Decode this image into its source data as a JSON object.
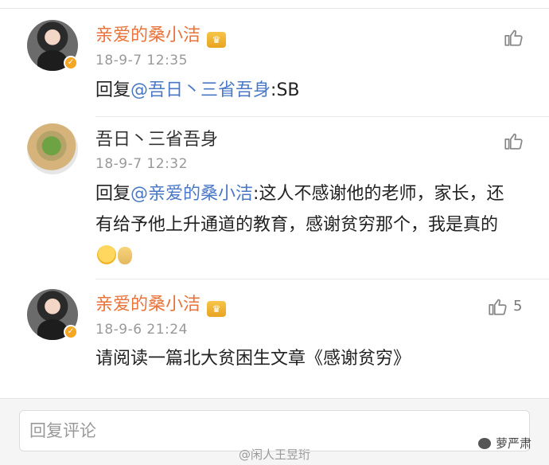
{
  "comments": [
    {
      "username": "亲爱的桑小洁",
      "timestamp": "18-9-7 12:35",
      "reply_prefix": "回复",
      "mention": "@吾日丶三省吾身",
      "text": ":SB",
      "like_count": ""
    },
    {
      "username": "吾日丶三省吾身",
      "timestamp": "18-9-7 12:32",
      "reply_prefix": "回复",
      "mention": "@亲爱的桑小洁",
      "text": ":这人不感谢他的老师，家长，还有给予他上升通道的教育，感谢贫穷那个，我是真的",
      "like_count": ""
    },
    {
      "username": "亲爱的桑小洁",
      "timestamp": "18-9-6 21:24",
      "text": "请阅读一篇北大贫困生文章《感谢贫穷》",
      "like_count": "5"
    }
  ],
  "reply_input": {
    "placeholder": "回复评论"
  },
  "watermark": "@闲人王昱珩",
  "brand": "萝严肃",
  "colors": {
    "vip_name": "#e8733b",
    "mention": "#4a78c6",
    "timestamp": "#999999"
  },
  "icons": [
    "thumbs-up-icon",
    "verified-badge-icon",
    "vip-crown-icon",
    "smile-emoji-icon",
    "cry-emoji-icon"
  ]
}
